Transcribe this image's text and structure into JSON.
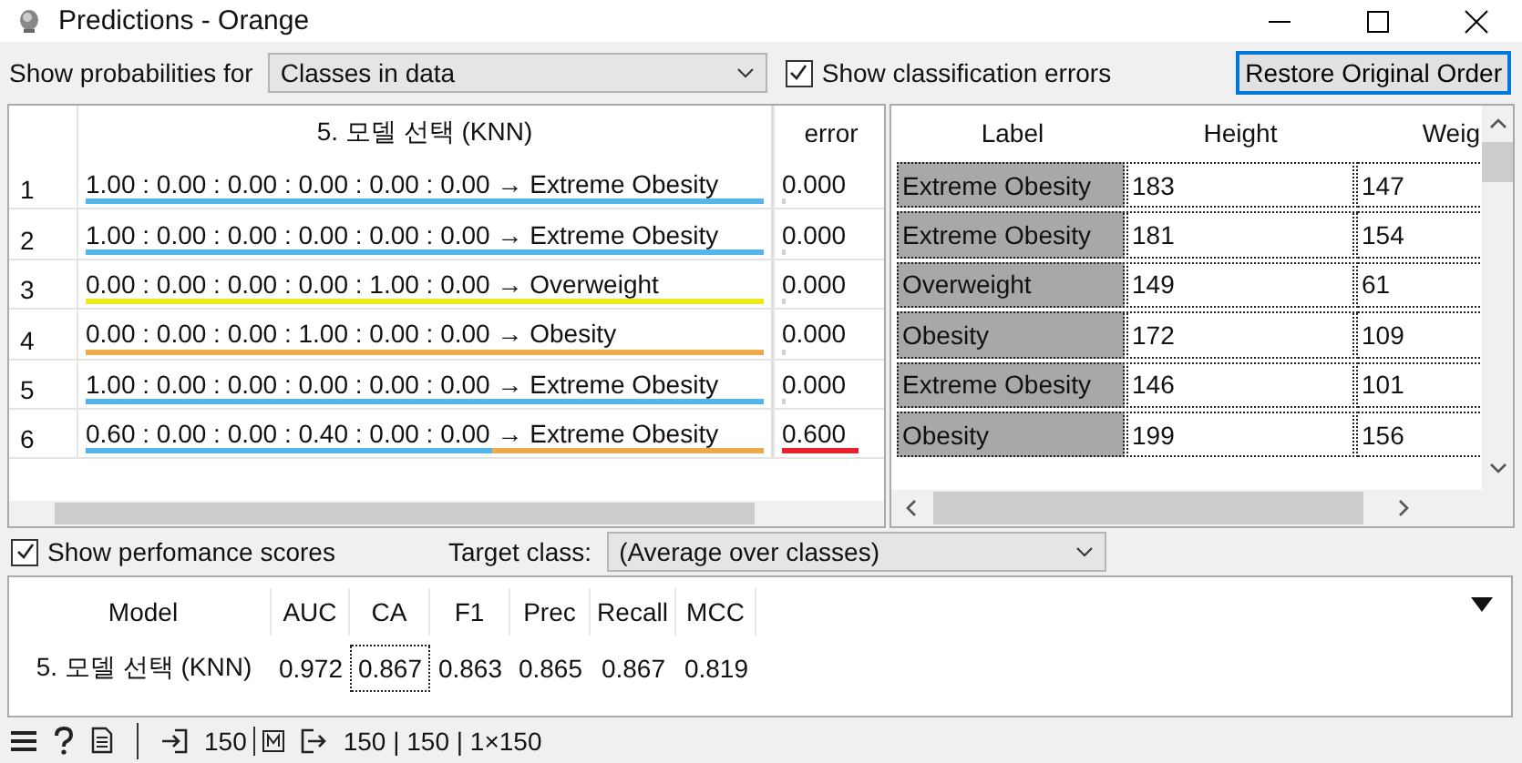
{
  "window": {
    "title": "Predictions - Orange"
  },
  "controls": {
    "probabilities_label": "Show probabilities for",
    "probabilities_value": "Classes in data",
    "show_errors": {
      "label": "Show classification errors",
      "checked": true
    },
    "restore_button": "Restore Original Order"
  },
  "predictions": {
    "columns": [
      "5. 모델 선택 (KNN)",
      "error"
    ],
    "rows": [
      {
        "index": "1",
        "prediction": "1.00 : 0.00 : 0.00 : 0.00 : 0.00 : 0.00 → Extreme Obesity",
        "segments": [
          {
            "color": "#55b4ea",
            "level": 1
          }
        ],
        "error": "0.000",
        "error_bar": {
          "level": 0
        }
      },
      {
        "index": "2",
        "prediction": "1.00 : 0.00 : 0.00 : 0.00 : 0.00 : 0.00 → Extreme Obesity",
        "segments": [
          {
            "color": "#55b4ea",
            "level": 1
          }
        ],
        "error": "0.000",
        "error_bar": {
          "level": 0
        }
      },
      {
        "index": "3",
        "prediction": "0.00 : 0.00 : 0.00 : 0.00 : 1.00 : 0.00 → Overweight",
        "segments": [
          {
            "color": "#eaea1a",
            "level": 1
          }
        ],
        "error": "0.000",
        "error_bar": {
          "level": 0
        }
      },
      {
        "index": "4",
        "prediction": "0.00 : 0.00 : 0.00 : 1.00 : 0.00 : 0.00 → Obesity",
        "segments": [
          {
            "color": "#eea94a",
            "level": 1
          }
        ],
        "error": "0.000",
        "error_bar": {
          "level": 0
        }
      },
      {
        "index": "5",
        "prediction": "1.00 : 0.00 : 0.00 : 0.00 : 0.00 : 0.00 → Extreme Obesity",
        "segments": [
          {
            "color": "#55b4ea",
            "level": 1
          }
        ],
        "error": "0.000",
        "error_bar": {
          "level": 0
        }
      },
      {
        "index": "6",
        "prediction": "0.60 : 0.00 : 0.00 : 0.40 : 0.00 : 0.00 → Extreme Obesity",
        "segments": [
          {
            "color": "#55b4ea",
            "level": 0.6
          },
          {
            "color": "#eea94a",
            "level": 0.4
          }
        ],
        "error": "0.600",
        "error_bar": {
          "level": 0.6
        }
      }
    ]
  },
  "data_table": {
    "columns": [
      "Label",
      "Height",
      "Weig"
    ],
    "rows": [
      [
        "Extreme Obesity",
        "183",
        "147"
      ],
      [
        "Extreme Obesity",
        "181",
        "154"
      ],
      [
        "Overweight",
        "149",
        "61"
      ],
      [
        "Obesity",
        "172",
        "109"
      ],
      [
        "Extreme Obesity",
        "146",
        "101"
      ],
      [
        "Obesity",
        "199",
        "156"
      ]
    ]
  },
  "performance": {
    "show_scores": {
      "label": "Show perfomance scores",
      "checked": true
    },
    "target_label": "Target class:",
    "target_value": "(Average over classes)",
    "columns": [
      "Model",
      "AUC",
      "CA",
      "F1",
      "Prec",
      "Recall",
      "MCC"
    ],
    "rows": [
      [
        "5. 모델 선택 (KNN)",
        "0.972",
        "0.867",
        "0.863",
        "0.865",
        "0.867",
        "0.819"
      ]
    ]
  },
  "status_bar": {
    "input_count": "150",
    "output_text": "150 | 150 | 1×150"
  }
}
